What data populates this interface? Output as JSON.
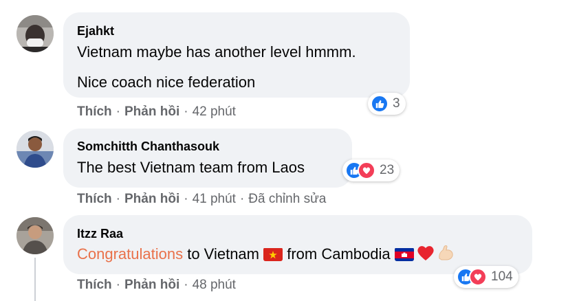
{
  "comments": [
    {
      "author": "Ejahkt",
      "lines": [
        "Vietnam maybe has another level hmmm.",
        "Nice coach nice federation"
      ],
      "actions": {
        "like": "Thích",
        "reply": "Phản hồi",
        "time": "42 phút"
      },
      "reactions": {
        "count": "3",
        "types": [
          "like-icon"
        ]
      }
    },
    {
      "author": "Somchitth Chanthasouk",
      "lines": [
        "The best Vietnam team from Laos"
      ],
      "actions": {
        "like": "Thích",
        "reply": "Phản hồi",
        "time": "41 phút",
        "edited": "Đã chỉnh sửa"
      },
      "reactions": {
        "count": "23",
        "types": [
          "like-icon",
          "love-icon"
        ]
      }
    },
    {
      "author": "Itzz Raa",
      "text_parts": {
        "highlight": "Congratulations",
        "part1": " to Vietnam ",
        "part2": " from Cambodia "
      },
      "emojis": [
        "vietnam-flag-icon",
        "cambodia-flag-icon",
        "red-heart-icon",
        "flexed-biceps-icon"
      ],
      "actions": {
        "like": "Thích",
        "reply": "Phản hồi",
        "time": "48 phút"
      },
      "reactions": {
        "count": "104",
        "types": [
          "like-icon",
          "love-icon"
        ]
      }
    }
  ],
  "colors": {
    "bubble": "#f0f2f5",
    "meta_text": "#65676b",
    "like_blue": "#1877f2",
    "love_red": "#f33e58",
    "highlight_orange": "#e9714a"
  }
}
